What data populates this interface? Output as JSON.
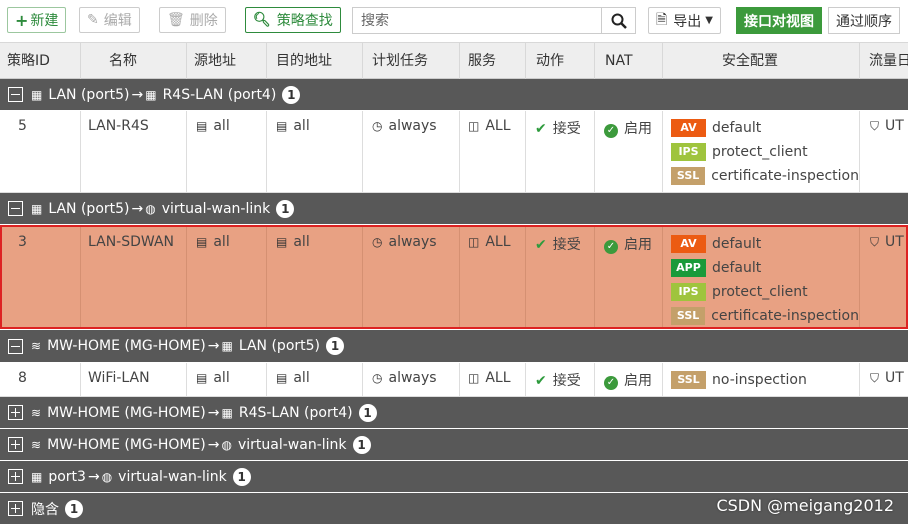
{
  "toolbar": {
    "new_label": "新建",
    "edit_label": "编辑",
    "delete_label": "删除",
    "policy_lookup_label": "策略查找",
    "search_placeholder": "搜索",
    "export_label": "导出",
    "view_interface_label": "接口对视图",
    "view_sequence_label": "通过顺序"
  },
  "columns": [
    "策略ID",
    "名称",
    "源地址",
    "目的地址",
    "计划任务",
    "服务",
    "动作",
    "NAT",
    "安全配置",
    "流量日"
  ],
  "groups": [
    {
      "src": "LAN (port5)",
      "arrow": "→",
      "dst": "R4S-LAN (port4)",
      "count": "1",
      "expanded": true,
      "rows": [
        {
          "id": "5",
          "name": "LAN-R4S",
          "src": "all",
          "dst": "all",
          "schedule": "always",
          "service": "ALL",
          "action": "接受",
          "nat": "启用",
          "profiles": [
            {
              "tag": "AV",
              "color": "#ec5b12",
              "name": "default"
            },
            {
              "tag": "IPS",
              "color": "#9fc43d",
              "name": "protect_client"
            },
            {
              "tag": "SSL",
              "color": "#c4a06a",
              "name": "certificate-inspection"
            }
          ],
          "log": "UT"
        }
      ]
    },
    {
      "src": "LAN (port5)",
      "arrow": "→",
      "dst": "virtual-wan-link",
      "count": "1",
      "expanded": true,
      "rows": [
        {
          "id": "3",
          "name": "LAN-SDWAN",
          "src": "all",
          "dst": "all",
          "schedule": "always",
          "service": "ALL",
          "action": "接受",
          "nat": "启用",
          "profiles": [
            {
              "tag": "AV",
              "color": "#ec5b12",
              "name": "default"
            },
            {
              "tag": "APP",
              "color": "#1a9a3a",
              "name": "default"
            },
            {
              "tag": "IPS",
              "color": "#9fc43d",
              "name": "protect_client"
            },
            {
              "tag": "SSL",
              "color": "#c4a06a",
              "name": "certificate-inspection"
            }
          ],
          "log": "UT"
        }
      ]
    },
    {
      "src": "MW-HOME (MG-HOME)",
      "arrow": "→",
      "dst": "LAN (port5)",
      "count": "1",
      "expanded": true,
      "rows": [
        {
          "id": "8",
          "name": "WiFi-LAN",
          "src": "all",
          "dst": "all",
          "schedule": "always",
          "service": "ALL",
          "action": "接受",
          "nat": "启用",
          "profiles": [
            {
              "tag": "SSL",
              "color": "#c4a06a",
              "name": "no-inspection"
            }
          ],
          "log": "UT"
        }
      ]
    },
    {
      "src": "MW-HOME (MG-HOME)",
      "arrow": "→",
      "dst": "R4S-LAN (port4)",
      "count": "1",
      "expanded": false
    },
    {
      "src": "MW-HOME (MG-HOME)",
      "arrow": "→",
      "dst": "virtual-wan-link",
      "count": "1",
      "expanded": false
    },
    {
      "src": "port3",
      "arrow": "→",
      "dst": "virtual-wan-link",
      "count": "1",
      "expanded": false
    },
    {
      "src": "隐含",
      "count": "1",
      "expanded": false
    }
  ],
  "watermark": "CSDN @meigang2012"
}
